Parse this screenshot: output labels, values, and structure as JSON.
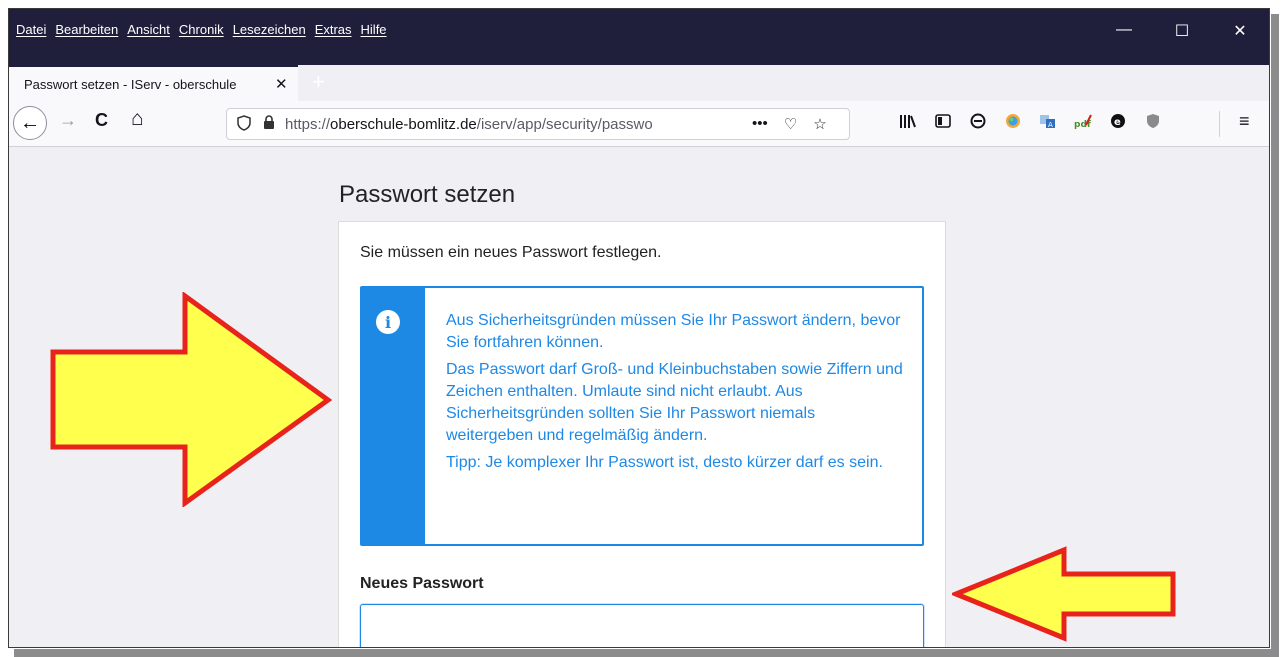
{
  "menu": [
    "Datei",
    "Bearbeiten",
    "Ansicht",
    "Chronik",
    "Lesezeichen",
    "Extras",
    "Hilfe"
  ],
  "window_controls": {
    "minimize": "—",
    "maximize": "☐",
    "close": "✕"
  },
  "tab": {
    "title": "Passwort setzen - IServ - oberschule",
    "close": "✕"
  },
  "newtab": "+",
  "nav": {
    "back": "←",
    "forward": "→",
    "reload": "C",
    "home": "⌂"
  },
  "url": {
    "prefix": "https://",
    "host": "oberschule-bomlitz.de",
    "path": "/iserv/app/security/passwo",
    "more": "•••",
    "pocket": "♡",
    "star": "☆"
  },
  "toolbar_icons": [
    "library-icon",
    "sidebar-icon",
    "account-icon",
    "colorful-extension-icon",
    "translate-icon",
    "pdf-extension-icon",
    "circle-e-icon",
    "shield-extension-icon"
  ],
  "hamburger": "≡",
  "page": {
    "title": "Passwort setzen",
    "intro": "Sie müssen ein neues Passwort festlegen.",
    "info_icon": "i",
    "alert_p1": "Aus Sicherheitsgründen müssen Sie Ihr Passwort ändern, bevor Sie fortfahren können.",
    "alert_p2": "Das Passwort darf Groß- und Kleinbuchstaben sowie Ziffern und Zeichen enthalten. Umlaute sind nicht erlaubt. Aus Sicherheitsgründen sollten Sie Ihr Passwort niemals weitergeben und regelmäßig ändern.",
    "alert_p3": "Tipp: Je komplexer Ihr Passwort ist, desto kürzer darf es sein.",
    "new_password_label": "Neues Passwort",
    "new_password_value": ""
  },
  "colors": {
    "accent": "#1e88e5",
    "titlebar": "#1f1e3b",
    "arrow_fill": "#ffff4d",
    "arrow_stroke": "#e8231c"
  }
}
